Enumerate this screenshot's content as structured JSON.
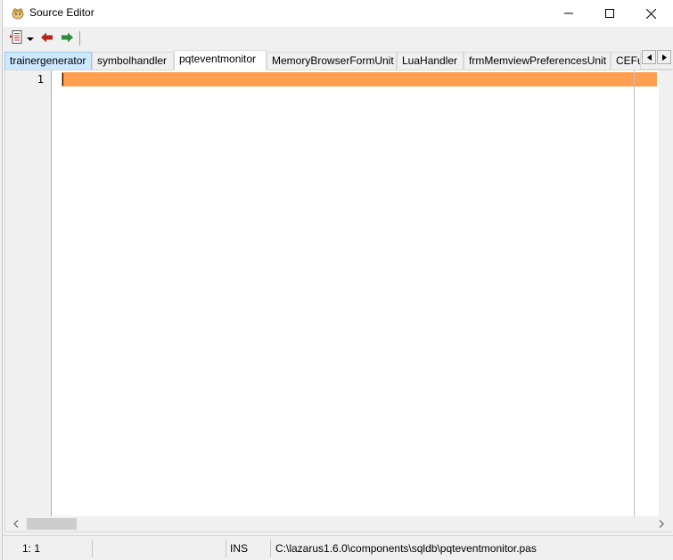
{
  "window": {
    "title": "Source Editor",
    "app_icon": "lazarus-icon",
    "controls": {
      "minimize": "minimize-icon",
      "maximize": "maximize-icon",
      "close": "close-icon"
    }
  },
  "toolbar": {
    "items": [
      {
        "name": "source-menu-button",
        "icon": "document-list-icon"
      },
      {
        "name": "jump-back-button",
        "icon": "arrow-left-icon",
        "color": "#b3261e"
      },
      {
        "name": "jump-forward-button",
        "icon": "arrow-right-icon",
        "color": "#2e8b3a"
      }
    ]
  },
  "tabs": [
    {
      "label": "trainergenerator",
      "state": "hover"
    },
    {
      "label": "symbolhandler",
      "state": "normal"
    },
    {
      "label": "pqteventmonitor",
      "state": "selected"
    },
    {
      "label": "MemoryBrowserFormUnit",
      "state": "normal"
    },
    {
      "label": "LuaHandler",
      "state": "normal"
    },
    {
      "label": "frmMemviewPreferencesUnit",
      "state": "normal"
    },
    {
      "label": "CEFu",
      "state": "normal"
    }
  ],
  "editor": {
    "lines": [
      {
        "number": "1",
        "text": ""
      }
    ],
    "current_line_color": "#ff9e4f"
  },
  "statusbar": {
    "position": "1:  1",
    "mode": "INS",
    "file_path": "C:\\lazarus1.6.0\\components\\sqldb\\pqteventmonitor.pas"
  }
}
